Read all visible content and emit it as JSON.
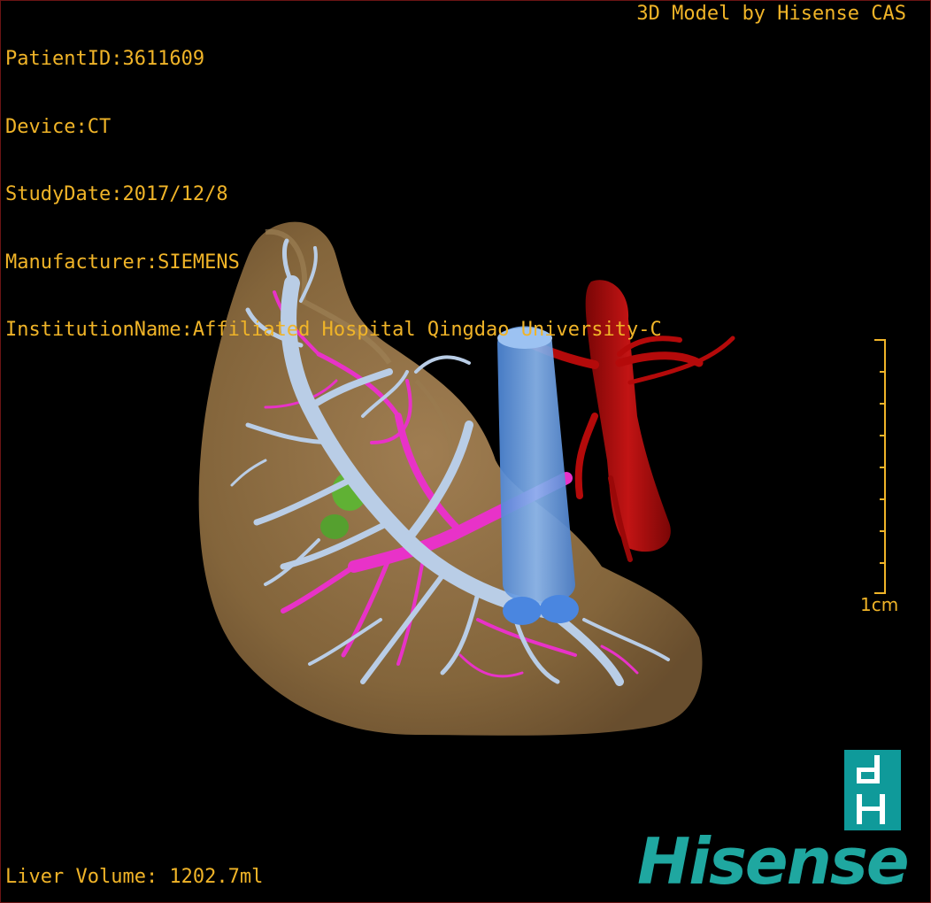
{
  "patient_info": {
    "patient_id": "PatientID:3611609",
    "device": "Device:CT",
    "study_date": "StudyDate:2017/12/8",
    "manufacturer": "Manufacturer:SIEMENS",
    "institution": "InstitutionName:Affiliated Hospital Qingdao University-C"
  },
  "watermark": "3D Model by Hisense CAS",
  "liver_volume": "Liver Volume: 1202.7ml",
  "scale_bar": {
    "label": "1cm"
  },
  "brand": {
    "name": "Hisense"
  },
  "colors": {
    "overlay_text": "#f0b428",
    "liver": "#8a6a3e",
    "portal_vein": "#b9cde6",
    "hepatic_artery": "#e832c8",
    "vena_cava": "#5a94e0",
    "aorta": "#b40a0a",
    "lesion": "#5ab832",
    "brand": "#1fa7a0"
  }
}
